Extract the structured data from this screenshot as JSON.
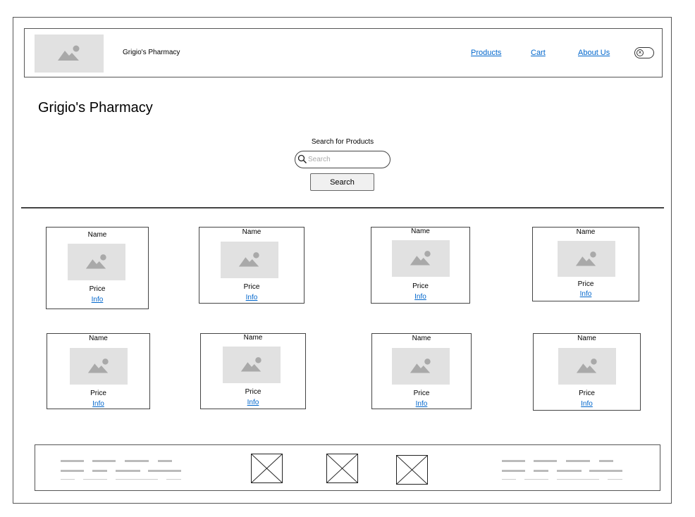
{
  "header": {
    "brand": "Grigio's Pharmacy",
    "nav": [
      {
        "label": "Products"
      },
      {
        "label": "Cart"
      },
      {
        "label": "About Us"
      }
    ],
    "toggle_icon": "close-icon"
  },
  "main": {
    "title": "Grigio's Pharmacy",
    "search_label": "Search for Products",
    "search_placeholder": "Search",
    "search_button": "Search"
  },
  "products": [
    {
      "name": "Name",
      "price": "Price",
      "info": "Info"
    },
    {
      "name": "Name",
      "price": "Price",
      "info": "Info"
    },
    {
      "name": "Name",
      "price": "Price",
      "info": "Info"
    },
    {
      "name": "Name",
      "price": "Price",
      "info": "Info"
    },
    {
      "name": "Name",
      "price": "Price",
      "info": "Info"
    },
    {
      "name": "Name",
      "price": "Price",
      "info": "Info"
    },
    {
      "name": "Name",
      "price": "Price",
      "info": "Info"
    },
    {
      "name": "Name",
      "price": "Price",
      "info": "Info"
    }
  ],
  "colors": {
    "link": "#0066cc",
    "placeholder_bg": "#e1e1e1",
    "placeholder_icon": "#a9a9a9"
  },
  "footer": {
    "icons": [
      "placeholder-image-icon",
      "placeholder-image-icon",
      "placeholder-image-icon"
    ]
  }
}
